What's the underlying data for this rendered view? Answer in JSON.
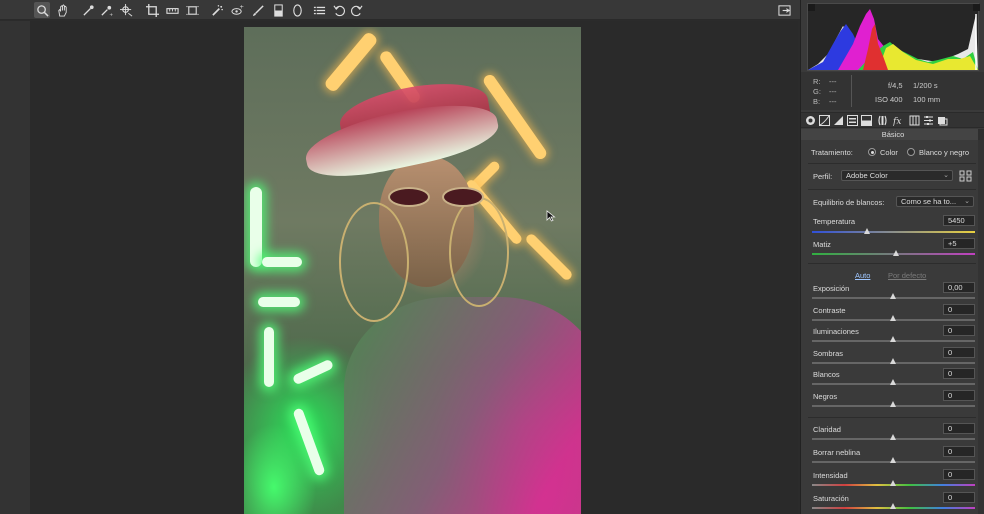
{
  "toolbar": {
    "tools": [
      {
        "icon": "zoom-icon",
        "active": true
      },
      {
        "icon": "hand-icon"
      },
      {
        "icon": "white-balance-eyedropper-icon"
      },
      {
        "icon": "color-sampler-icon"
      },
      {
        "icon": "target-adjustment-icon"
      },
      {
        "icon": "crop-icon"
      },
      {
        "icon": "straighten-icon"
      },
      {
        "icon": "transform-icon"
      },
      {
        "icon": "spot-removal-icon"
      },
      {
        "icon": "red-eye-icon"
      },
      {
        "icon": "adjustment-brush-icon"
      },
      {
        "icon": "graduated-filter-icon"
      },
      {
        "icon": "radial-filter-icon"
      },
      {
        "icon": "presets-list-icon"
      },
      {
        "icon": "rotate-left-icon"
      },
      {
        "icon": "rotate-right-icon"
      }
    ],
    "export_icon": "open-dialog-icon"
  },
  "readout": {
    "r_label": "R:",
    "g_label": "G:",
    "b_label": "B:",
    "r_value": "---",
    "g_value": "---",
    "b_value": "---",
    "aperture": "f/4,5",
    "shutter": "1/200 s",
    "iso": "ISO 400",
    "focal": "100 mm"
  },
  "panel_tabs": [
    "basic-icon",
    "tone-curve-icon",
    "detail-icon",
    "hsl-icon",
    "split-toning-icon",
    "lens-icon",
    "effects-fx-icon",
    "camera-calibration-icon",
    "presets-icon",
    "snapshots-icon"
  ],
  "section_title": "Básico",
  "treatment": {
    "label": "Tratamiento:",
    "option_color": "Color",
    "option_bw": "Blanco y negro",
    "selected": "Color"
  },
  "profile": {
    "label": "Perfil:",
    "value": "Adobe Color",
    "browser_icon": "profile-browser-grid-icon"
  },
  "white_balance": {
    "label": "Equilibrio de blancos:",
    "value": "Como se ha to..."
  },
  "wb_sliders": [
    {
      "label": "Temperatura",
      "value": "5450",
      "position": 0.34,
      "gradient": "linear-gradient(90deg,#3050d8,#e8d040)"
    },
    {
      "label": "Matiz",
      "value": "+5",
      "position": 0.52,
      "gradient": "linear-gradient(90deg,#30b040,#c040c0)"
    }
  ],
  "auto_link": "Auto",
  "default_link": "Por defecto",
  "tone_sliders": [
    {
      "label": "Exposición",
      "value": "0,00",
      "position": 0.5
    },
    {
      "label": "Contraste",
      "value": "0",
      "position": 0.5
    },
    {
      "label": "Iluminaciones",
      "value": "0",
      "position": 0.5
    },
    {
      "label": "Sombras",
      "value": "0",
      "position": 0.5
    },
    {
      "label": "Blancos",
      "value": "0",
      "position": 0.5
    },
    {
      "label": "Negros",
      "value": "0",
      "position": 0.5
    }
  ],
  "presence_sliders": [
    {
      "label": "Claridad",
      "value": "0",
      "position": 0.5
    },
    {
      "label": "Borrar neblina",
      "value": "0",
      "position": 0.5
    },
    {
      "label": "Intensidad",
      "value": "0",
      "position": 0.5,
      "gradient": "linear-gradient(90deg,#888,#d04040,#e0c040,#40c040,#4080e0,#c040c0)"
    },
    {
      "label": "Saturación",
      "value": "0",
      "position": 0.5,
      "gradient": "linear-gradient(90deg,#888,#d04040,#e0c040,#40c040,#4080e0,#c040c0)"
    }
  ],
  "colors": {
    "link_active": "#9ec6ff",
    "link_disabled": "#7a7a7a"
  }
}
